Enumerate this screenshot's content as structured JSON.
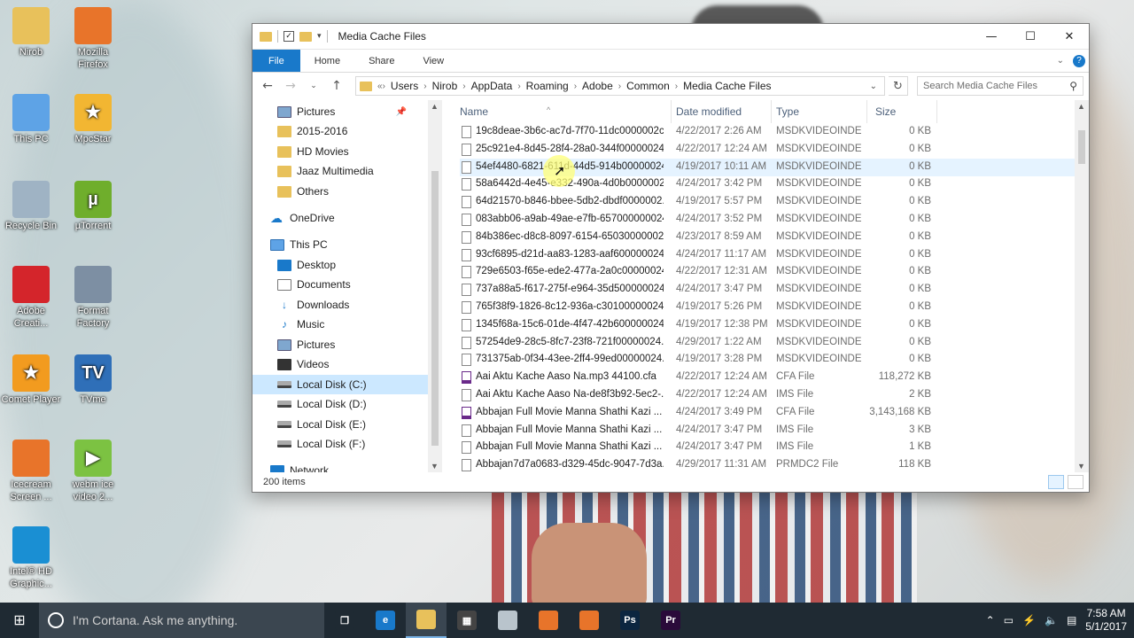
{
  "window": {
    "title": "Media Cache Files",
    "ribbon_tabs": [
      "File",
      "Home",
      "Share",
      "View"
    ],
    "help": "?",
    "status": "200 items"
  },
  "address": {
    "prefix": "«",
    "crumbs": [
      "Users",
      "Nirob",
      "AppData",
      "Roaming",
      "Adobe",
      "Common",
      "Media Cache Files"
    ],
    "search_placeholder": "Search Media Cache Files"
  },
  "navpane": {
    "items": [
      {
        "label": "Pictures",
        "icon": "pictures-icon"
      },
      {
        "label": "2015-2016",
        "icon": "folder-icon"
      },
      {
        "label": "HD Movies",
        "icon": "folder-icon"
      },
      {
        "label": "Jaaz Multimedia",
        "icon": "folder-icon"
      },
      {
        "label": "Others",
        "icon": "folder-icon"
      },
      {
        "label": "OneDrive",
        "icon": "onedrive-icon"
      },
      {
        "label": "This PC",
        "icon": "this-pc-icon"
      },
      {
        "label": "Desktop",
        "icon": "desktop-icon"
      },
      {
        "label": "Documents",
        "icon": "documents-icon"
      },
      {
        "label": "Downloads",
        "icon": "downloads-icon"
      },
      {
        "label": "Music",
        "icon": "music-icon"
      },
      {
        "label": "Pictures",
        "icon": "pictures-icon"
      },
      {
        "label": "Videos",
        "icon": "videos-icon"
      },
      {
        "label": "Local Disk (C:)",
        "icon": "disk-icon"
      },
      {
        "label": "Local Disk (D:)",
        "icon": "disk-icon"
      },
      {
        "label": "Local Disk (E:)",
        "icon": "disk-icon"
      },
      {
        "label": "Local Disk (F:)",
        "icon": "disk-icon"
      },
      {
        "label": "Network",
        "icon": "network-icon"
      }
    ]
  },
  "columns": {
    "name": "Name",
    "date": "Date modified",
    "type": "Type",
    "size": "Size"
  },
  "files": [
    {
      "name": "19c8deae-3b6c-ac7d-7f70-11dc0000002c....",
      "date": "4/22/2017 2:26 AM",
      "type": "MSDKVIDEOINDE...",
      "size": "0 KB"
    },
    {
      "name": "25c921e4-8d45-28f4-28a0-344f00000024....",
      "date": "4/22/2017 12:24 AM",
      "type": "MSDKVIDEOINDE...",
      "size": "0 KB"
    },
    {
      "name": "54ef4480-6821-611d-44d5-914b00000024....",
      "date": "4/19/2017 10:11 AM",
      "type": "MSDKVIDEOINDE...",
      "size": "0 KB"
    },
    {
      "name": "58a6442d-4e45-e332-490a-4d0b00000024....",
      "date": "4/24/2017 3:42 PM",
      "type": "MSDKVIDEOINDE...",
      "size": "0 KB"
    },
    {
      "name": "64d21570-b846-bbee-5db2-dbdf0000002....",
      "date": "4/19/2017 5:57 PM",
      "type": "MSDKVIDEOINDE...",
      "size": "0 KB"
    },
    {
      "name": "083abb06-a9ab-49ae-e7fb-657000000024....",
      "date": "4/24/2017 3:52 PM",
      "type": "MSDKVIDEOINDE...",
      "size": "0 KB"
    },
    {
      "name": "84b386ec-d8c8-8097-6154-650300000024....",
      "date": "4/23/2017 8:59 AM",
      "type": "MSDKVIDEOINDE...",
      "size": "0 KB"
    },
    {
      "name": "93cf6895-d21d-aa83-1283-aaf600000024....",
      "date": "4/24/2017 11:17 AM",
      "type": "MSDKVIDEOINDE...",
      "size": "0 KB"
    },
    {
      "name": "729e6503-f65e-ede2-477a-2a0c00000024....",
      "date": "4/22/2017 12:31 AM",
      "type": "MSDKVIDEOINDE...",
      "size": "0 KB"
    },
    {
      "name": "737a88a5-f617-275f-e964-35d500000024....",
      "date": "4/24/2017 3:47 PM",
      "type": "MSDKVIDEOINDE...",
      "size": "0 KB"
    },
    {
      "name": "765f38f9-1826-8c12-936a-c30100000024....",
      "date": "4/19/2017 5:26 PM",
      "type": "MSDKVIDEOINDE...",
      "size": "0 KB"
    },
    {
      "name": "1345f68a-15c6-01de-4f47-42b600000024....",
      "date": "4/19/2017 12:38 PM",
      "type": "MSDKVIDEOINDE...",
      "size": "0 KB"
    },
    {
      "name": "57254de9-28c5-8fc7-23f8-721f00000024....",
      "date": "4/29/2017 1:22 AM",
      "type": "MSDKVIDEOINDE...",
      "size": "0 KB"
    },
    {
      "name": "731375ab-0f34-43ee-2ff4-99ed00000024....",
      "date": "4/19/2017 3:28 PM",
      "type": "MSDKVIDEOINDE...",
      "size": "0 KB"
    },
    {
      "name": "Aai Aktu Kache Aaso Na.mp3 44100.cfa",
      "date": "4/22/2017 12:24 AM",
      "type": "CFA File",
      "size": "118,272 KB",
      "cfa": true
    },
    {
      "name": "Aai Aktu Kache Aaso Na-de8f3b92-5ec2-...",
      "date": "4/22/2017 12:24 AM",
      "type": "IMS File",
      "size": "2 KB"
    },
    {
      "name": "Abbajan  Full Movie  Manna  Shathi  Kazi ...",
      "date": "4/24/2017 3:49 PM",
      "type": "CFA File",
      "size": "3,143,168 KB",
      "cfa": true
    },
    {
      "name": "Abbajan  Full Movie  Manna  Shathi  Kazi ...",
      "date": "4/24/2017 3:47 PM",
      "type": "IMS File",
      "size": "3 KB"
    },
    {
      "name": "Abbajan  Full Movie  Manna  Shathi  Kazi ...",
      "date": "4/24/2017 3:47 PM",
      "type": "IMS File",
      "size": "1 KB"
    },
    {
      "name": "Abbajan7d7a0683-d329-45dc-9047-7d3a....",
      "date": "4/29/2017 11:31 AM",
      "type": "PRMDC2 File",
      "size": "118 KB"
    }
  ],
  "desktop_icons": [
    {
      "label": "Nirob",
      "color": "#e8c15b",
      "glyph": ""
    },
    {
      "label": "Mozilla Firefox",
      "color": "#e8742a",
      "glyph": ""
    },
    {
      "label": "This PC",
      "color": "#5ea3e6",
      "glyph": ""
    },
    {
      "label": "MpcStar",
      "color": "#f2b632",
      "glyph": "★"
    },
    {
      "label": "Recycle Bin",
      "color": "#9fb3c4",
      "glyph": ""
    },
    {
      "label": "µTorrent",
      "color": "#6fae2c",
      "glyph": "µ"
    },
    {
      "label": "Adobe Creati...",
      "color": "#d4252b",
      "glyph": ""
    },
    {
      "label": "Format Factory",
      "color": "#7d8fa3",
      "glyph": ""
    },
    {
      "label": "Comet Player",
      "color": "#f29b1f",
      "glyph": "★"
    },
    {
      "label": "TVme",
      "color": "#2f6fb8",
      "glyph": "TV"
    },
    {
      "label": "Icecream Screen ...",
      "color": "#e8742a",
      "glyph": ""
    },
    {
      "label": "webm ice video 2...",
      "color": "#7cc242",
      "glyph": "▶"
    },
    {
      "label": "Intel® HD Graphic...",
      "color": "#1a8fd3",
      "glyph": ""
    }
  ],
  "taskbar": {
    "cortana_placeholder": "I'm Cortana. Ask me anything.",
    "apps": [
      {
        "name": "task-view",
        "color": "#1f2a33",
        "glyph": "❐"
      },
      {
        "name": "edge",
        "color": "#1979ca",
        "glyph": "e"
      },
      {
        "name": "file-explorer",
        "color": "#e8c15b",
        "glyph": ""
      },
      {
        "name": "store",
        "color": "#444",
        "glyph": "▦"
      },
      {
        "name": "app-5",
        "color": "#b9c4cc",
        "glyph": ""
      },
      {
        "name": "icecream",
        "color": "#e8742a",
        "glyph": ""
      },
      {
        "name": "firefox",
        "color": "#e8742a",
        "glyph": ""
      },
      {
        "name": "photoshop",
        "color": "#0b2540",
        "glyph": "Ps"
      },
      {
        "name": "premiere",
        "color": "#2a0a3a",
        "glyph": "Pr"
      }
    ],
    "time": "7:58 AM",
    "date": "5/1/2017"
  }
}
